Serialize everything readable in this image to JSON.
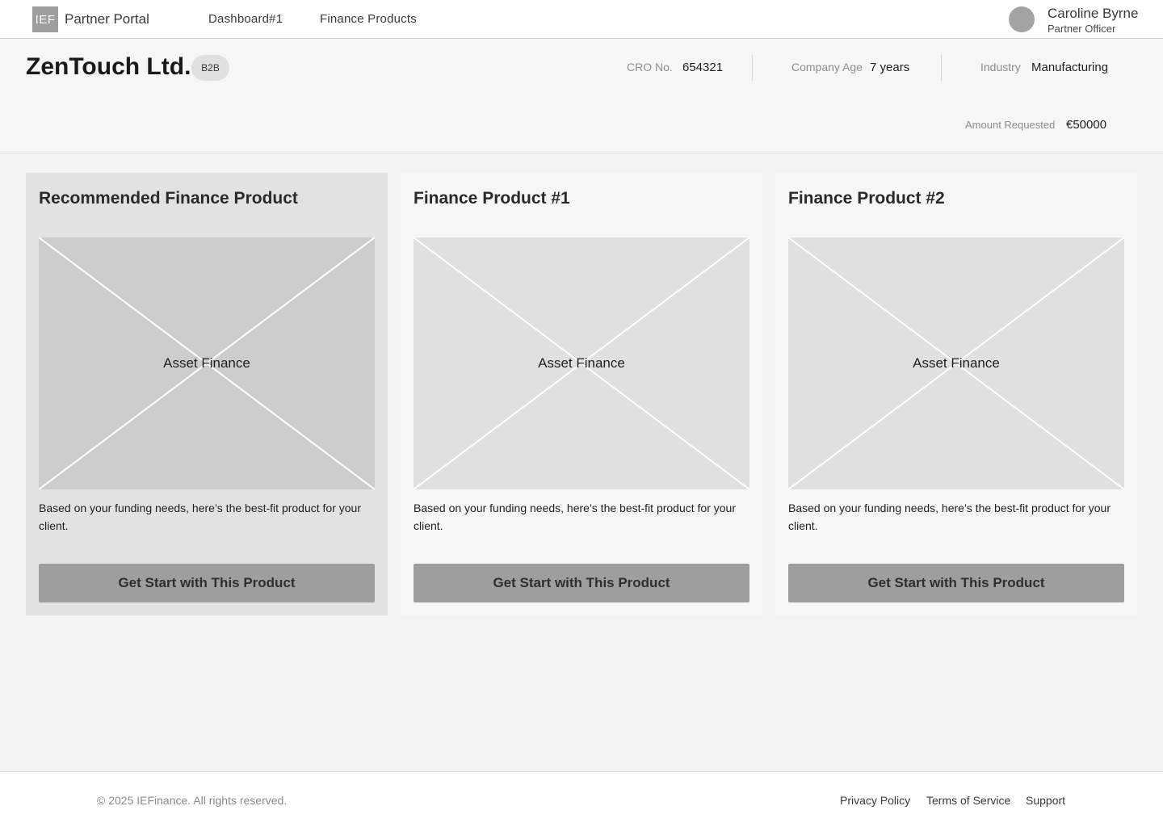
{
  "header": {
    "logo_text": "IEF",
    "portal_name": "Partner Portal",
    "nav": [
      {
        "label": "Dashboard#1"
      },
      {
        "label": "Finance Products"
      }
    ],
    "user": {
      "name": "Caroline Byrne",
      "role": "Partner Officer"
    }
  },
  "company": {
    "name": "ZenTouch Ltd.",
    "badge": "B2B",
    "cro_label": "CRO No.",
    "cro_value": "654321",
    "age_label": "Company Age",
    "age_value": "7 years",
    "industry_label": "Industry",
    "industry_value": "Manufacturing",
    "amount_label": "Amount Requested",
    "amount_value": "€50000"
  },
  "cards": [
    {
      "title": "Recommended Finance Product",
      "image_label": "Asset Finance",
      "description": "Based on your funding needs, here’s the best-fit product for your client.",
      "button": "Get Start with This Product",
      "recommended": true
    },
    {
      "title": "Finance Product #1",
      "image_label": "Asset Finance",
      "description": "Based on your funding needs, here’s the best-fit product for your client.",
      "button": "Get Start with This Product",
      "recommended": false
    },
    {
      "title": "Finance Product #2",
      "image_label": "Asset Finance",
      "description": "Based on your funding needs, here’s the best-fit product for your client.",
      "button": "Get Start with This Product",
      "recommended": false
    }
  ],
  "footer": {
    "copyright": "© 2025 IEFinance. All rights reserved.",
    "links": [
      {
        "label": "Privacy Policy"
      },
      {
        "label": "Terms of Service"
      },
      {
        "label": "Support"
      }
    ]
  },
  "colors": {
    "button": "#9e9e9e",
    "recommended_card": "#e2e2e2",
    "card": "#f6f6f6",
    "avatar": "#a3a3a3"
  }
}
